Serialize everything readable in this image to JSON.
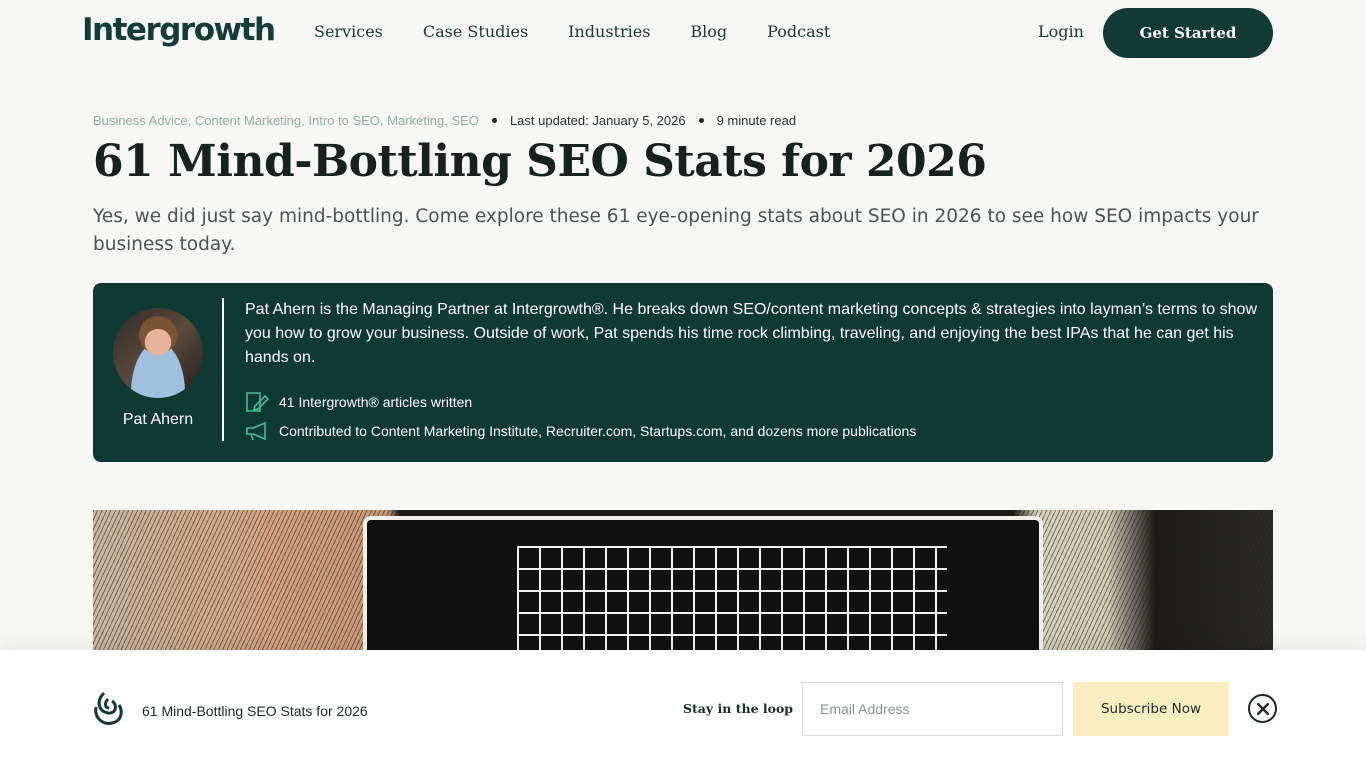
{
  "header": {
    "logo": "Intergrowth",
    "nav": [
      "Services",
      "Case Studies",
      "Industries",
      "Blog",
      "Podcast"
    ],
    "login": "Login",
    "cta": "Get Started"
  },
  "article": {
    "categories": [
      "Business Advice",
      "Content Marketing",
      "Intro to SEO",
      "Marketing",
      "SEO"
    ],
    "last_updated": "Last updated: January 5, 2026",
    "read_time": "9 minute read",
    "title": "61 Mind-Bottling SEO Stats for 2026",
    "subtitle": "Yes, we did just say mind-bottling. Come explore these 61 eye-opening stats about SEO in 2026 to see how SEO impacts your business today."
  },
  "author": {
    "name": "Pat Ahern",
    "bio": "Pat Ahern is the Managing Partner at Intergrowth®. He breaks down SEO/content marketing concepts & strategies into layman’s terms to show you how to grow your business. Outside of work, Pat spends his time rock climbing, traveling, and enjoying the best IPAs that he can get his hands on.",
    "articles": "41 Intergrowth® articles written",
    "contributed": "Contributed to Content Marketing Institute, Recruiter.com, Startups.com, and dozens more publications"
  },
  "sticky": {
    "title": "61 Mind-Bottling SEO Stats for 2026",
    "loop_label": "Stay in the loop",
    "email_placeholder": "Email Address",
    "subscribe": "Subscribe Now"
  },
  "colors": {
    "brand_dark": "#113a34",
    "category_green": "#8cb39f",
    "subscribe_bg": "#fbefc2"
  }
}
